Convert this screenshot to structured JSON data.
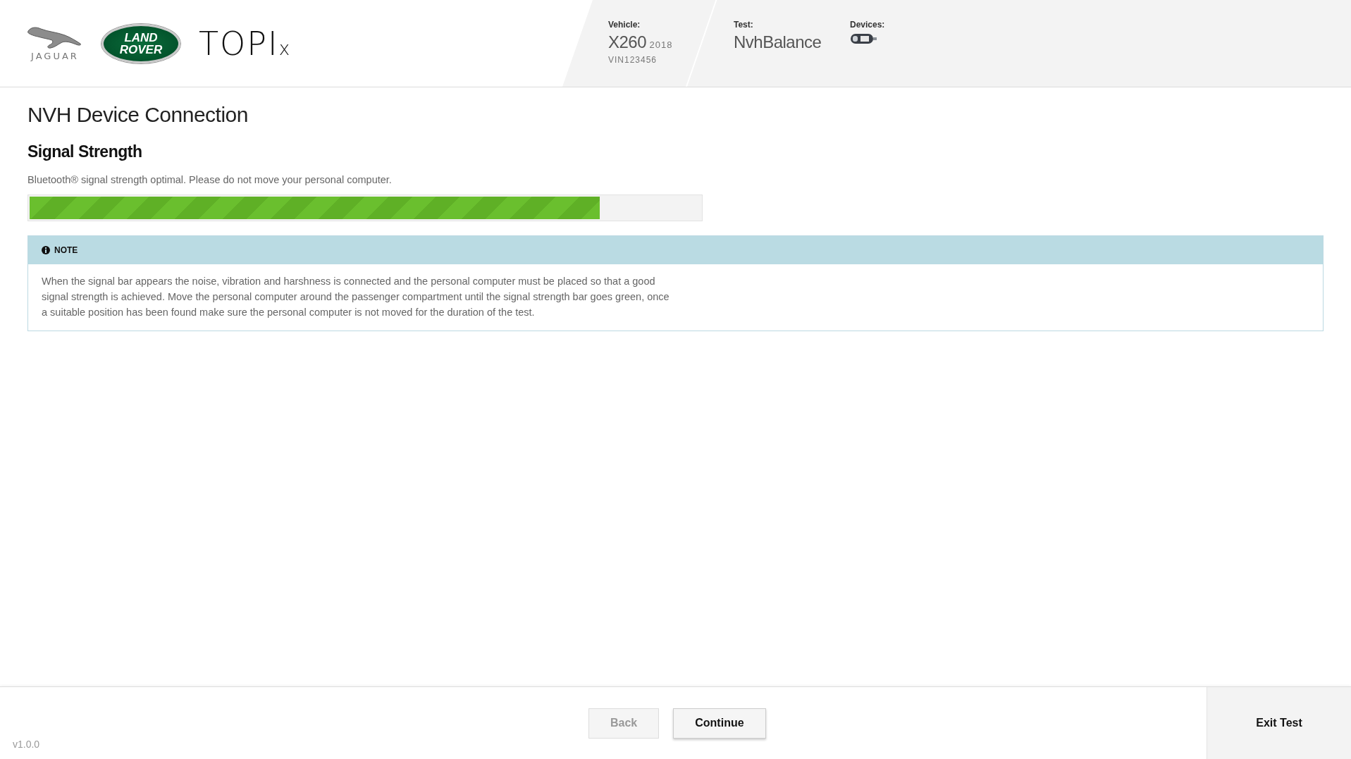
{
  "header": {
    "logos": [
      {
        "kind": "jaguar",
        "text": "JAGUAR"
      },
      {
        "kind": "landrover",
        "lines": [
          "LAND",
          "ROVER"
        ]
      },
      {
        "kind": "topix",
        "text": "TOPI",
        "suffix": "x"
      }
    ],
    "vehicle": {
      "label": "Vehicle:",
      "model": "X260",
      "year": "2018",
      "vin": "VIN123456"
    },
    "test": {
      "label": "Test:",
      "name": "NvhBalance"
    },
    "devices": {
      "label": "Devices:"
    }
  },
  "page": {
    "title": "NVH Device Connection",
    "section": "Signal Strength",
    "message": "Bluetooth® signal strength optimal. Please do not move your personal computer.",
    "signal": {
      "level": 0.85
    },
    "note": {
      "label": "NOTE",
      "text": "When the signal bar appears the noise, vibration and harshness is connected and the personal computer must be placed so that a good signal strength is achieved. Move the personal computer around the passenger compartment until the signal strength bar goes green, once a suitable position has been found make sure the personal computer is not moved for the duration of the test."
    }
  },
  "footer": {
    "version": "v1.0.0",
    "buttons": [
      {
        "label": "Back",
        "disabled": true
      },
      {
        "label": "Continue",
        "disabled": false
      }
    ],
    "exit": "Exit Test"
  }
}
